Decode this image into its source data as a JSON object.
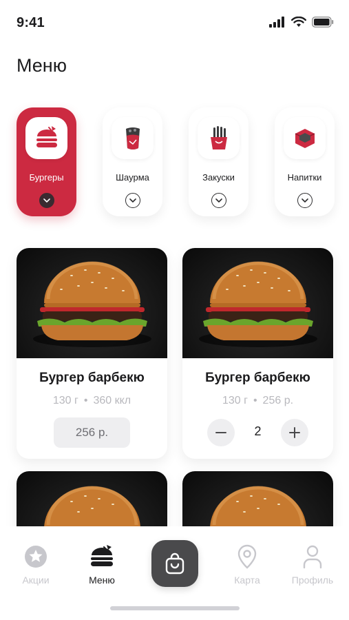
{
  "status": {
    "time": "9:41"
  },
  "page": {
    "title": "Меню"
  },
  "categories": [
    {
      "label": "Бургеры",
      "icon": "burger-icon",
      "active": true
    },
    {
      "label": "Шаурма",
      "icon": "shawarma-icon",
      "active": false
    },
    {
      "label": "Закуски",
      "icon": "fries-icon",
      "active": false
    },
    {
      "label": "Напитки",
      "icon": "drink-box-icon",
      "active": false
    }
  ],
  "products": [
    {
      "name": "Бургер барбекю",
      "weight": "130 г",
      "meta2": "360 ккл",
      "price": "256 р."
    },
    {
      "name": "Бургер барбекю",
      "weight": "130 г",
      "meta2": "256 р.",
      "quantity": "2"
    }
  ],
  "tabbar": {
    "promo": "Акции",
    "menu": "Меню",
    "map": "Карта",
    "profile": "Профиль"
  },
  "colors": {
    "accent": "#cc2a41",
    "cart": "#4a4a4c",
    "inactive": "#c7c7cc"
  }
}
